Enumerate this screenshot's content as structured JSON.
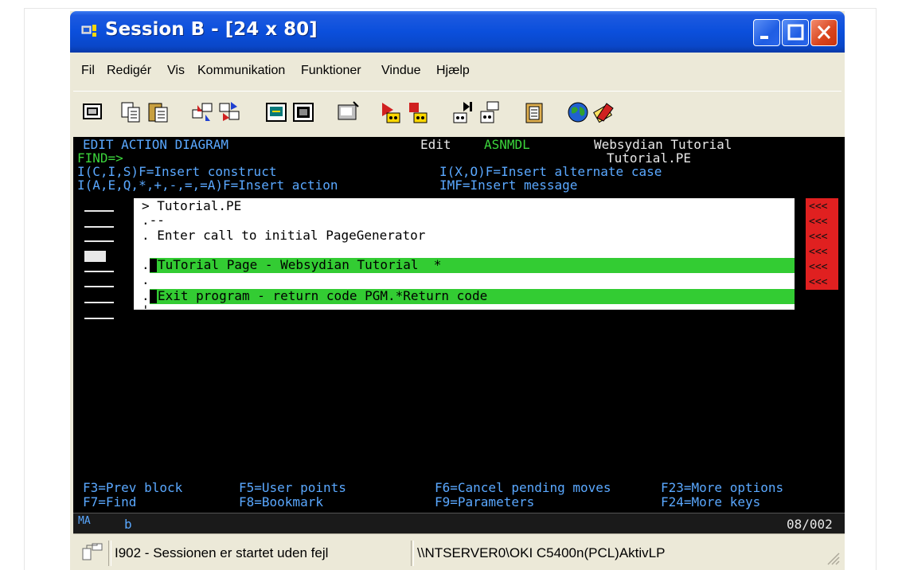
{
  "window": {
    "title": "Session B - [24 x 80]"
  },
  "menu": [
    "Fil",
    "Redigér",
    "Vis",
    "Kommunikation",
    "Funktioner",
    "Vindue",
    "Hjælp"
  ],
  "toolbar_icons": [
    "display-session-icon",
    "copy-icon",
    "paste-icon",
    "send-icon",
    "receive-icon",
    "macro-icon",
    "record-icon",
    "keyboard-map-icon",
    "play-macro-icon",
    "stop-macro-icon",
    "print-screen-icon",
    "print-icon",
    "clipboard-icon",
    "web-icon",
    "edit-icon"
  ],
  "terminal": {
    "header_title": "EDIT ACTION DIAGRAM",
    "mode": "Edit",
    "model": "ASNMDL",
    "app_name": "Websydian Tutorial",
    "find_label": "FIND=>",
    "object_name": "Tutorial.PE",
    "help1_left": "I(C,I,S)F=Insert construct",
    "help1_right": "I(X,O)F=Insert alternate case",
    "help2_left": "I(A,E,Q,*,+,-,=,=A)F=Insert action",
    "help2_right": "IMF=Insert message",
    "lines": [
      "> Tutorial.PE",
      ".--",
      ". Enter call to initial PageGenerator",
      "TuTorial Page - Websydian Tutorial  *",
      ".",
      "Exit program - return code PGM.*Return code",
      "'--"
    ],
    "red_marker": "<<<",
    "fkeys_row1": [
      "F3=Prev block",
      "F5=User points",
      "F6=Cancel pending moves",
      "F23=More options"
    ],
    "fkeys_row2": [
      "F7=Find",
      "F8=Bookmark",
      "F9=Parameters",
      "F24=More keys"
    ],
    "oia_left": "MA",
    "oia_session": "b",
    "cursor_pos": "08/002"
  },
  "statusbar": {
    "message": "I902 - Sessionen er startet uden fejl",
    "printer": "\\\\NTSERVER0\\OKI C5400n(PCL)AktivLP"
  },
  "colors": {
    "title_blue": "#0b4fdc",
    "terminal_green": "#33cc33",
    "terminal_bg": "#000000",
    "marker_red": "#e02020",
    "close_red": "#d9441c"
  }
}
